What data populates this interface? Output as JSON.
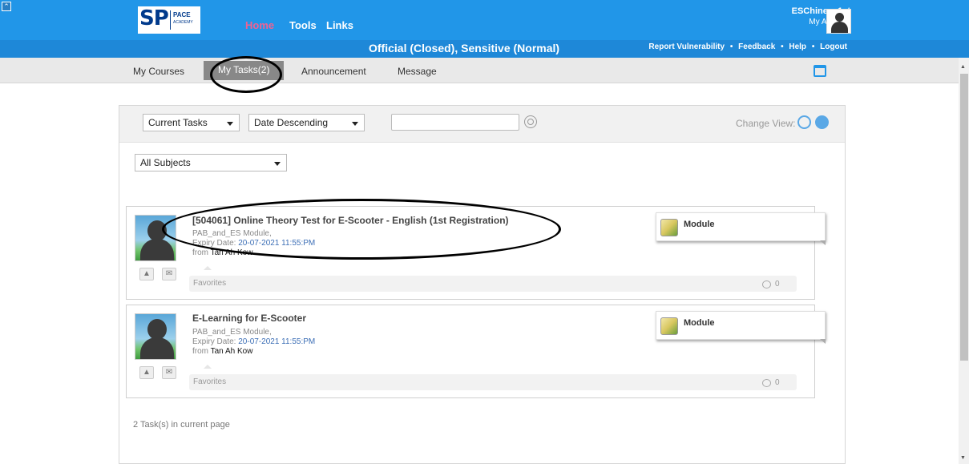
{
  "header": {
    "logo_text": "SP",
    "logo_sub": "PACE",
    "logo_sub2": "ACADEMY",
    "nav": [
      "Home",
      "Tools",
      "Links"
    ],
    "active_nav": "Home",
    "account_name": "ESChinese1st",
    "account_link": "My Account",
    "classification": "Official (Closed), Sensitive (Normal)",
    "top_links": [
      "Report Vulnerability",
      "Feedback",
      "Help",
      "Logout"
    ],
    "top_link_sep": "•"
  },
  "tabs": [
    {
      "label": "My Courses",
      "active": false
    },
    {
      "label": "My Tasks(2)",
      "active": true
    },
    {
      "label": "Announcement",
      "active": false
    },
    {
      "label": "Message",
      "active": false
    }
  ],
  "filters": {
    "task_filter": "Current Tasks",
    "sort": "Date Descending",
    "search_value": "",
    "subject": "All Subjects",
    "change_view_label": "Change View:"
  },
  "tasks": [
    {
      "title": "[504061] Online Theory Test for E-Scooter - English (1st Registration)",
      "module": "PAB_and_ES Module,",
      "expiry_label": "Expiry Date:",
      "expiry_date": "20-07-2021 11:55:PM",
      "from_label": "from",
      "from_name": "Tan Ah Kow",
      "favorites_label": "Favorites",
      "comment_count": "0",
      "type": "Module"
    },
    {
      "title": "E-Learning for E-Scooter",
      "module": "PAB_and_ES Module,",
      "expiry_label": "Expiry Date:",
      "expiry_date": "20-07-2021 11:55:PM",
      "from_label": "from",
      "from_name": "Tan Ah Kow",
      "favorites_label": "Favorites",
      "comment_count": "0",
      "type": "Module"
    }
  ],
  "footer": {
    "count_text": "2 Task(s) in current page"
  },
  "colors": {
    "header_blue": "#2196e8",
    "active_nav": "#f06292",
    "tab_active": "#888888",
    "date_blue": "#3d6fb6"
  },
  "icons": [
    "collapse-icon",
    "calendar-icon",
    "search-icon",
    "list-view-icon",
    "grid-view-icon",
    "pin-icon",
    "message-icon",
    "comment-icon",
    "module-icon"
  ]
}
